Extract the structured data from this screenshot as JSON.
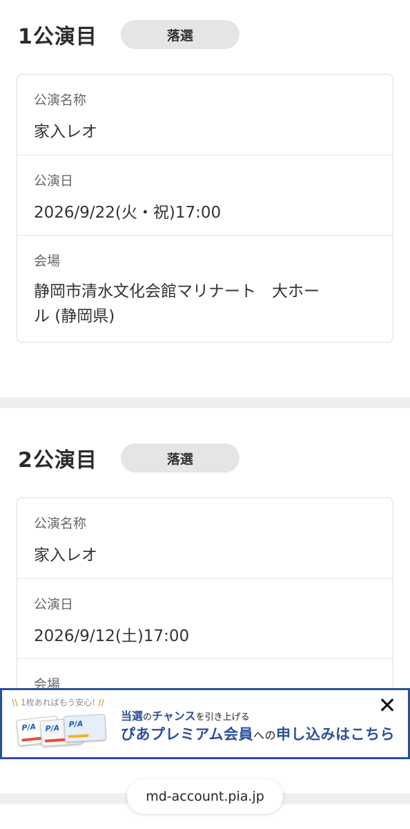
{
  "lotteries": [
    {
      "title": "1公演目",
      "status": "落選",
      "fields": {
        "name_label": "公演名称",
        "name_value": "家入レオ",
        "date_label": "公演日",
        "date_value": "2026/9/22(火・祝)17:00",
        "venue_label": "会場",
        "venue_value_line1": "静岡市清水文化会館マリナート　大ホー",
        "venue_value_line2": "ル (静岡県)"
      }
    },
    {
      "title": "2公演目",
      "status": "落選",
      "fields": {
        "name_label": "公演名称",
        "name_value": "家入レオ",
        "date_label": "公演日",
        "date_value": "2026/9/12(土)17:00",
        "venue_label": "会場"
      }
    }
  ],
  "banner": {
    "sub_text": "1枚あればもう安心!",
    "line1_a": "当選",
    "line1_b": "の",
    "line1_c": "チャンス",
    "line1_d": "を引き上げる",
    "line2_a": "ぴあプレミアム会員",
    "line2_b": "への",
    "line2_c": "申し込みはこちら",
    "card_logo": "P/A",
    "close_icon": "close-icon",
    "border_color": "#29509a"
  },
  "browser": {
    "url": "md-account.pia.jp"
  }
}
